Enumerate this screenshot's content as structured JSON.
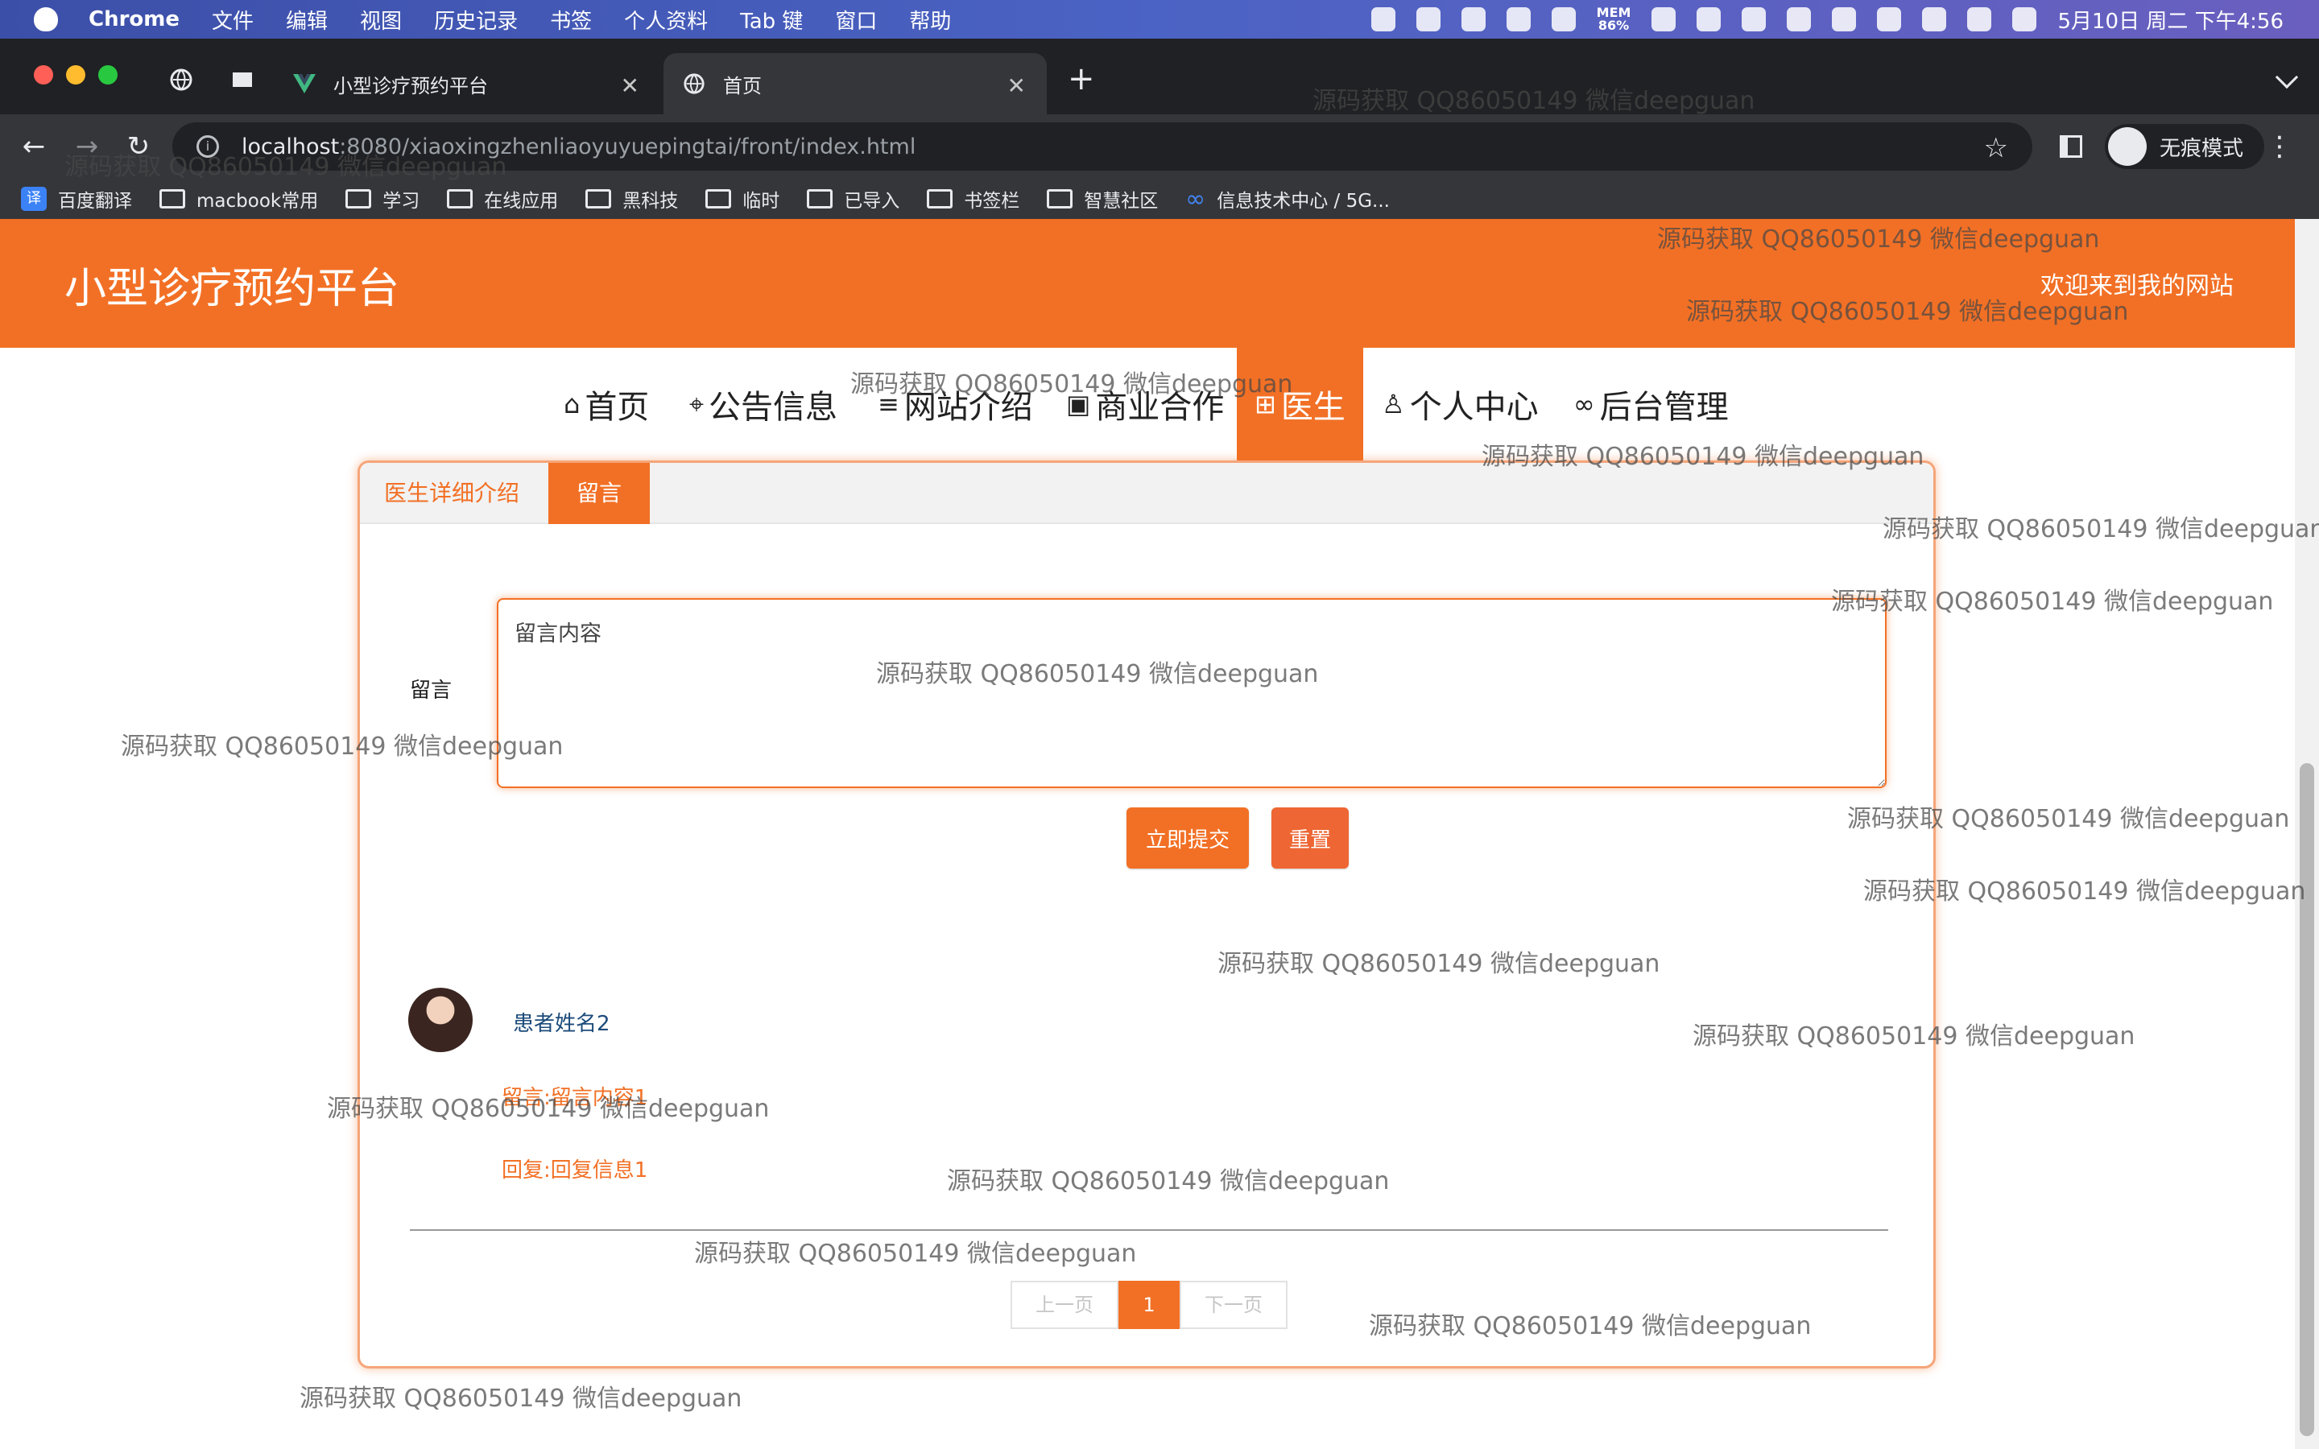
{
  "menubar": {
    "app": "Chrome",
    "items": [
      "文件",
      "编辑",
      "视图",
      "历史记录",
      "书签",
      "个人资料",
      "Tab 键",
      "窗口",
      "帮助"
    ],
    "memory_label": "MEM",
    "memory_value": "86%",
    "clock": "5月10日 周二 下午4:56"
  },
  "tabs": [
    {
      "title": "小型诊疗预约平台",
      "favicon": "vue-logo-icon"
    },
    {
      "title": "首页",
      "favicon": "globe-icon",
      "active": true
    }
  ],
  "toolbar": {
    "url_host": "localhost",
    "url_path": ":8080/xiaoxingzhenliaoyuyuepingtai/front/index.html",
    "profile_label": "无痕模式"
  },
  "bookmarks": [
    "百度翻译",
    "macbook常用",
    "学习",
    "在线应用",
    "黑科技",
    "临时",
    "已导入",
    "书签栏",
    "智慧社区",
    "信息技术中心 / 5G..."
  ],
  "site": {
    "title": "小型诊疗预约平台",
    "welcome": "欢迎来到我的网站",
    "brand_color": "#f27025"
  },
  "nav": [
    {
      "label": "首页",
      "icon": "home-icon"
    },
    {
      "label": "公告信息",
      "icon": "tag-icon"
    },
    {
      "label": "网站介绍",
      "icon": "sliders-icon"
    },
    {
      "label": "商业合作",
      "icon": "gift-icon"
    },
    {
      "label": "医生",
      "icon": "grid-icon",
      "active": true
    },
    {
      "label": "个人中心",
      "icon": "user-icon"
    },
    {
      "label": "后台管理",
      "icon": "link-icon"
    }
  ],
  "detail": {
    "tabs": [
      "医生详细介绍",
      "留言"
    ],
    "active_tab": 1,
    "form_label": "留言",
    "textarea_placeholder": "留言内容",
    "submit_label": "立即提交",
    "reset_label": "重置"
  },
  "comments": [
    {
      "user": "患者姓名2",
      "message": "留言:留言内容1",
      "reply": "回复:回复信息1"
    }
  ],
  "pagination": {
    "prev": "上一页",
    "current": "1",
    "next": "下一页"
  },
  "watermark": "源码获取 QQ86050149 微信deepguan"
}
